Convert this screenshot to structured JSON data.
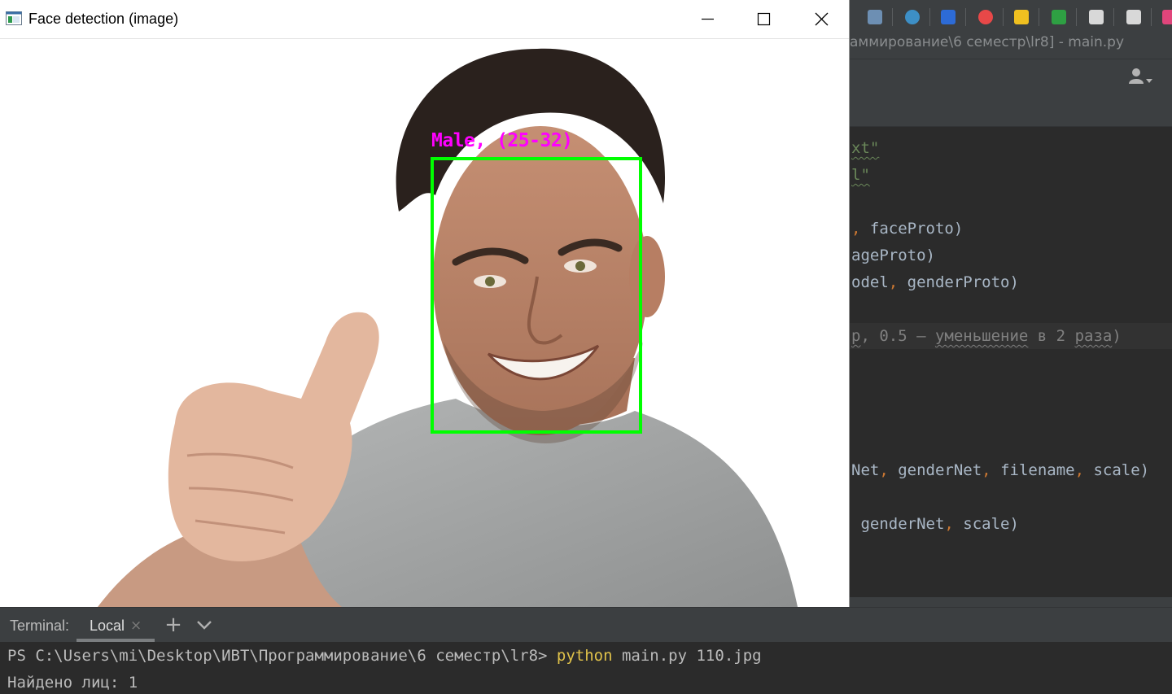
{
  "ide": {
    "title_fragment": "аммирование\\6 семестр\\lr8] - main.py",
    "code_lines": [
      {
        "parts": [
          {
            "t": "xt\"",
            "cls": "str squig"
          }
        ]
      },
      {
        "parts": [
          {
            "t": "l\"",
            "cls": "str squig"
          }
        ]
      },
      {
        "parts": []
      },
      {
        "parts": [
          {
            "t": ", ",
            "cls": "sep"
          },
          {
            "t": "faceProto)",
            "cls": ""
          }
        ]
      },
      {
        "parts": [
          {
            "t": "ageProto)",
            "cls": ""
          }
        ]
      },
      {
        "parts": [
          {
            "t": "odel",
            "cls": ""
          },
          {
            "t": ", ",
            "cls": "sep"
          },
          {
            "t": "genderProto)",
            "cls": ""
          }
        ]
      },
      {
        "parts": []
      },
      {
        "parts": [
          {
            "t": "p",
            "cls": "cmt squig-g"
          },
          {
            "t": ", 0.5 — ",
            "cls": "cmt"
          },
          {
            "t": "уменьшение",
            "cls": "cmt squig-g"
          },
          {
            "t": " в 2 ",
            "cls": "cmt"
          },
          {
            "t": "раза",
            "cls": "cmt squig-g"
          },
          {
            "t": ")",
            "cls": "cmt"
          }
        ]
      },
      {
        "parts": []
      },
      {
        "parts": []
      },
      {
        "parts": []
      },
      {
        "parts": []
      },
      {
        "parts": [
          {
            "t": "Net",
            "cls": ""
          },
          {
            "t": ", ",
            "cls": "sep"
          },
          {
            "t": "genderNet",
            "cls": ""
          },
          {
            "t": ", ",
            "cls": "sep"
          },
          {
            "t": "filename",
            "cls": ""
          },
          {
            "t": ", ",
            "cls": "sep"
          },
          {
            "t": "scale)",
            "cls": ""
          }
        ]
      },
      {
        "parts": []
      },
      {
        "parts": [
          {
            "t": " genderNet",
            "cls": ""
          },
          {
            "t": ", ",
            "cls": "sep"
          },
          {
            "t": "scale)",
            "cls": ""
          }
        ]
      }
    ]
  },
  "window": {
    "title": "Face detection (image)",
    "controls": {
      "minimize": "minimize",
      "maximize": "maximize",
      "close": "close"
    }
  },
  "detection": {
    "label": "Male, (25-32)",
    "box_color": "#00ff00",
    "label_color": "#ff00ff"
  },
  "terminal": {
    "title": "Terminal:",
    "tab_label": "Local",
    "tab_close": "×",
    "add_label": "+",
    "prompt": "PS C:\\Users\\mi\\Desktop\\ИВТ\\Программирование\\6 семестр\\lr8> ",
    "command": "python",
    "args": " main.py 110.jpg",
    "output": "Найдено лиц: 1"
  }
}
